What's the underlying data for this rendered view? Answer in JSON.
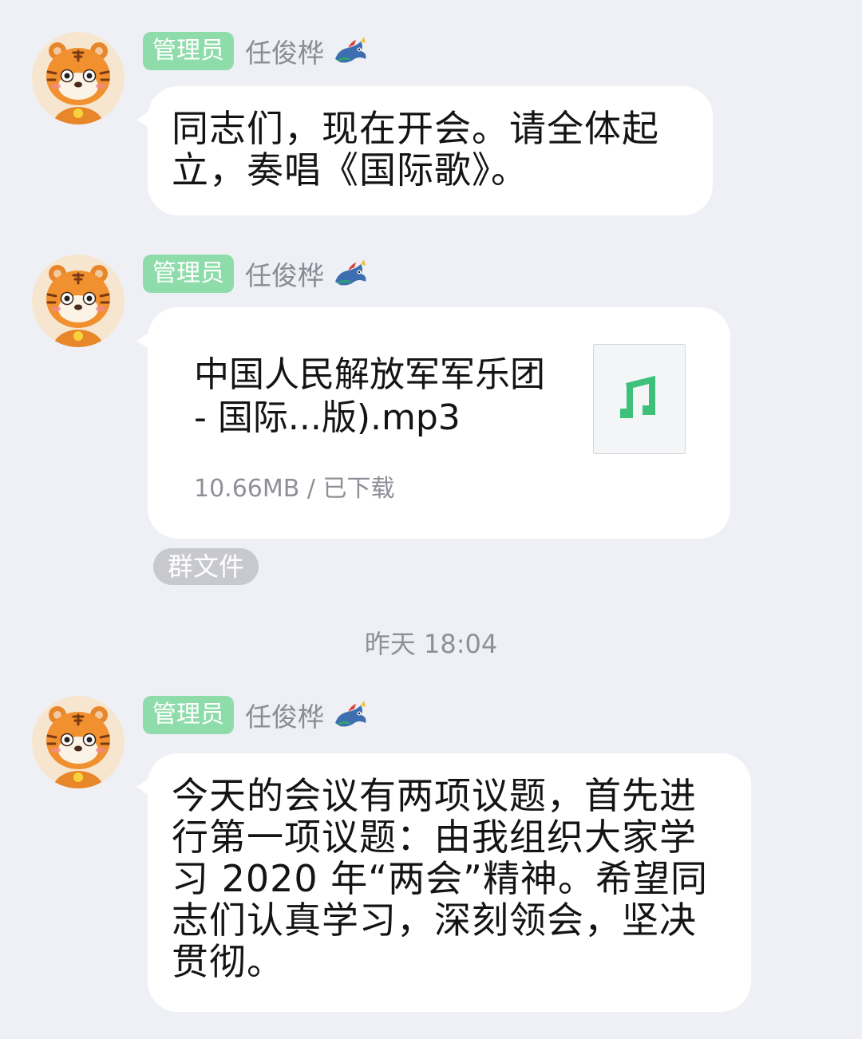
{
  "messages": [
    {
      "badge": "管理员",
      "sender": "任俊桦",
      "text": "同志们，现在开会。请全体起立，奏唱《国际歌》。"
    },
    {
      "badge": "管理员",
      "sender": "任俊桦",
      "file": {
        "name": "中国人民解放军军乐团 - 国际...版).mp3",
        "size_status": "10.66MB / 已下载",
        "icon": "music-note-icon"
      },
      "tag": "群文件"
    },
    {
      "badge": "管理员",
      "sender": "任俊桦",
      "text": "今天的会议有两项议题，首先进行第一项议题：由我组织大家学习 2020 年“两会”精神。希望同志们认真学习，深刻领会，坚决贯彻。"
    }
  ],
  "timestamp": "昨天 18:04",
  "colors": {
    "background": "#eff0f6",
    "bubble": "#ffffff",
    "badge": "#8fdcab",
    "music_icon": "#3cc07a"
  },
  "icons": {
    "avatar": "tiger-avatar",
    "sender_badge": "dragon-icon"
  }
}
